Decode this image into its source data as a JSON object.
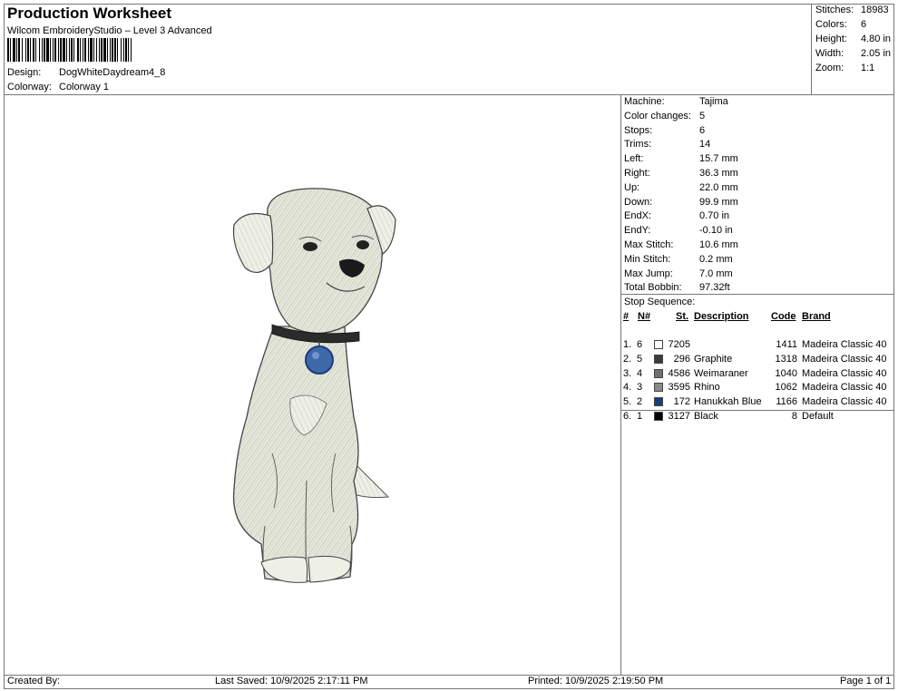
{
  "header": {
    "title": "Production Worksheet",
    "software": "Wilcom EmbroideryStudio – Level 3 Advanced",
    "design_label": "Design:",
    "design_value": "DogWhiteDaydream4_8",
    "colorway_label": "Colorway:",
    "colorway_value": "Colorway 1"
  },
  "summary": [
    {
      "label": "Stitches:",
      "value": "18983"
    },
    {
      "label": "Colors:",
      "value": "6"
    },
    {
      "label": "Height:",
      "value": "4.80 in"
    },
    {
      "label": "Width:",
      "value": "2.05 in"
    },
    {
      "label": "Zoom:",
      "value": "1:1"
    }
  ],
  "machine_info": [
    {
      "label": "Machine:",
      "value": "Tajima"
    },
    {
      "label": "Color changes:",
      "value": "5"
    },
    {
      "label": "Stops:",
      "value": "6"
    },
    {
      "label": "Trims:",
      "value": "14"
    },
    {
      "label": "Left:",
      "value": "15.7 mm"
    },
    {
      "label": "Right:",
      "value": "36.3 mm"
    },
    {
      "label": "Up:",
      "value": "22.0 mm"
    },
    {
      "label": "Down:",
      "value": "99.9 mm"
    },
    {
      "label": "EndX:",
      "value": "0.70 in"
    },
    {
      "label": "EndY:",
      "value": "-0.10 in"
    },
    {
      "label": "Max Stitch:",
      "value": "10.6 mm"
    },
    {
      "label": "Min Stitch:",
      "value": "0.2 mm"
    },
    {
      "label": "Max Jump:",
      "value": "7.0 mm"
    },
    {
      "label": "Total Bobbin:",
      "value": "97.32ft"
    }
  ],
  "stop_sequence": {
    "title": "Stop Sequence:",
    "headers": {
      "num": "#",
      "nnum": "N#",
      "st": "St.",
      "desc": "Description",
      "code": "Code",
      "brand": "Brand"
    },
    "rows": [
      {
        "num": "1.",
        "n": "6",
        "color": "#ffffff",
        "st": "7205",
        "desc": "",
        "code": "1411",
        "brand": "Madeira Classic 40"
      },
      {
        "num": "2.",
        "n": "5",
        "color": "#3a3a3a",
        "st": "296",
        "desc": "Graphite",
        "code": "1318",
        "brand": "Madeira Classic 40"
      },
      {
        "num": "3.",
        "n": "4",
        "color": "#707070",
        "st": "4586",
        "desc": "Weimaraner",
        "code": "1040",
        "brand": "Madeira Classic 40"
      },
      {
        "num": "4.",
        "n": "3",
        "color": "#8a8a86",
        "st": "3595",
        "desc": "Rhino",
        "code": "1062",
        "brand": "Madeira Classic 40"
      },
      {
        "num": "5.",
        "n": "2",
        "color": "#1c3c7c",
        "st": "172",
        "desc": "Hanukkah Blue",
        "code": "1166",
        "brand": "Madeira Classic 40"
      },
      {
        "num": "6.",
        "n": "1",
        "color": "#000000",
        "st": "3127",
        "desc": "Black",
        "code": "8",
        "brand": "Default"
      }
    ]
  },
  "footer": {
    "created_by": "Created By:",
    "last_saved": "Last Saved: 10/9/2025 2:17:11 PM",
    "printed": "Printed: 10/9/2025 2:19:50 PM",
    "page": "Page 1 of 1"
  },
  "design_preview": {
    "icon": "embroidered-dog-image"
  }
}
